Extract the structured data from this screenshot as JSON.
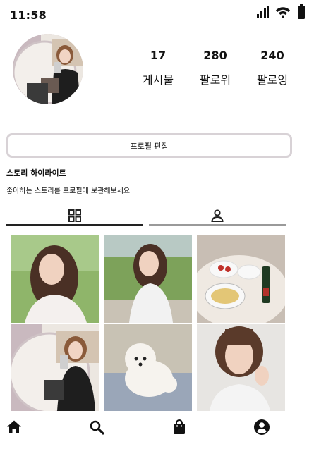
{
  "status_bar": {
    "time": "11:58"
  },
  "profile": {
    "stats": [
      {
        "value": "17",
        "label": "게시물"
      },
      {
        "value": "280",
        "label": "팔로워"
      },
      {
        "value": "240",
        "label": "팔로잉"
      }
    ],
    "edit_button": "프로필 편집"
  },
  "highlights": {
    "title": "스토리 하이라이트",
    "description": "좋아하는 스토리를 프로필에 보관해보세요"
  },
  "tabs": [
    {
      "icon": "grid-icon",
      "active": true
    },
    {
      "icon": "tagged-person-icon",
      "active": false
    }
  ],
  "posts": [
    {
      "subject": "woman-smiling-outdoors"
    },
    {
      "subject": "woman-sitting-in-garden"
    },
    {
      "subject": "table-with-food-and-wine"
    },
    {
      "subject": "mirror-selfie"
    },
    {
      "subject": "white-poodle-on-bed"
    },
    {
      "subject": "woman-with-bob-haircut"
    }
  ],
  "bottom_nav": [
    {
      "icon": "home-icon"
    },
    {
      "icon": "search-icon"
    },
    {
      "icon": "shopping-bag-icon"
    },
    {
      "icon": "profile-icon"
    }
  ]
}
